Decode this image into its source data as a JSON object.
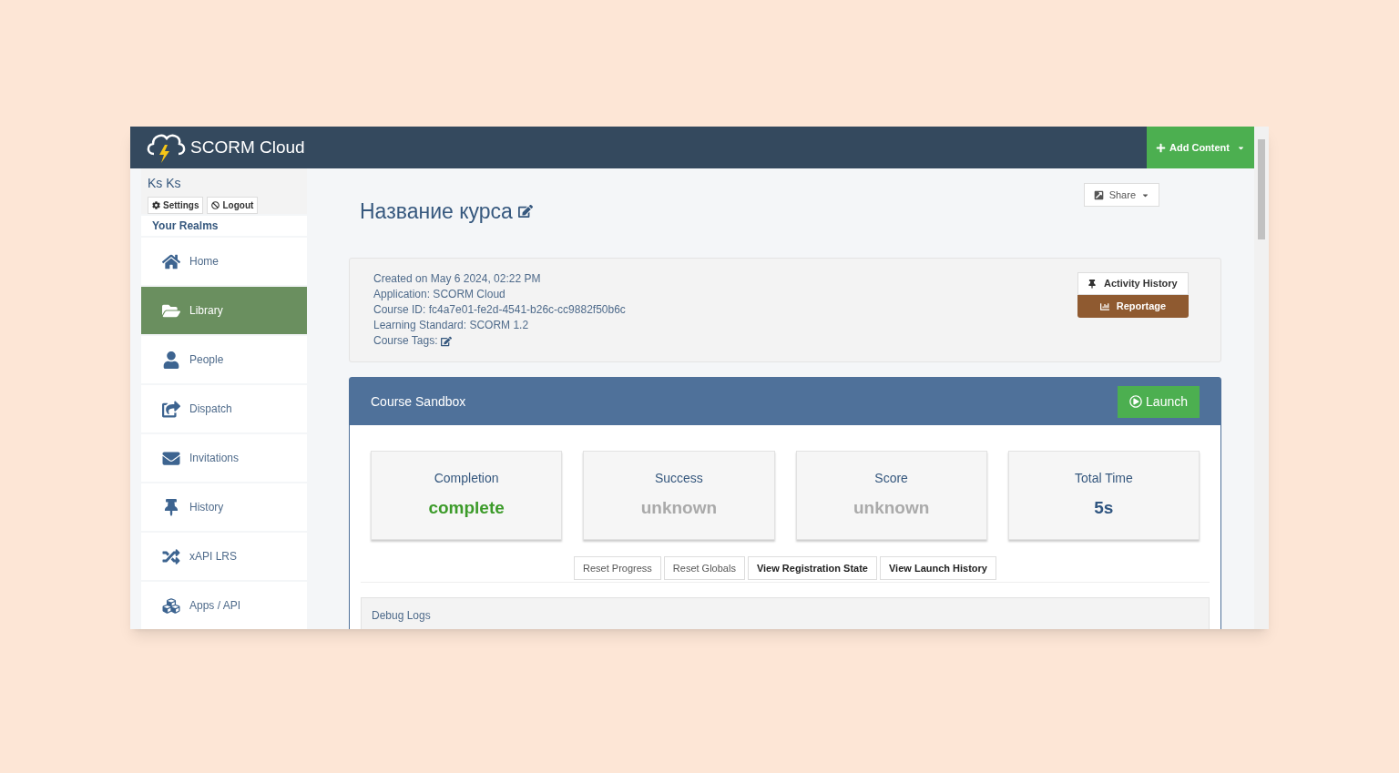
{
  "header": {
    "logo_text": "SCORM Cloud",
    "add_content_button": "Add Content"
  },
  "user": {
    "name": "Ks Ks",
    "buttons": [
      {
        "kind": "settings",
        "label": "Settings"
      },
      {
        "kind": "logout",
        "label": "Logout"
      }
    ]
  },
  "sidebar": {
    "heading": "Your Realms",
    "items": [
      {
        "kind": "home",
        "label": "Home",
        "selected": false
      },
      {
        "kind": "library",
        "label": "Library",
        "selected": true
      },
      {
        "kind": "people",
        "label": "People",
        "selected": false
      },
      {
        "kind": "dispatch",
        "label": "Dispatch",
        "selected": false
      },
      {
        "kind": "invitations",
        "label": "Invitations",
        "selected": false
      },
      {
        "kind": "history",
        "label": "History",
        "selected": false
      },
      {
        "kind": "xapi",
        "label": "xAPI LRS",
        "selected": false
      },
      {
        "kind": "apps",
        "label": "Apps / API",
        "selected": false
      }
    ]
  },
  "course": {
    "title": "Название курса",
    "share_button": "Share",
    "details": [
      "Created on May 6 2024, 02:22 PM",
      "Application: SCORM Cloud",
      "Course ID: fc4a7e01-fe2d-4541-b26c-cc9882f50b6c",
      "Learning Standard: SCORM 1.2",
      "Course Tags:"
    ],
    "activity_history_button": "Activity History",
    "reportage_button": "Reportage"
  },
  "sandbox": {
    "title": "Course Sandbox",
    "launch_button": "Launch",
    "metrics": [
      {
        "label": "Completion",
        "value": "complete",
        "color": "#3c9b2a"
      },
      {
        "label": "Success",
        "value": "unknown",
        "color": "#aaaaaa"
      },
      {
        "label": "Score",
        "value": "unknown",
        "color": "#aaaaaa"
      },
      {
        "label": "Total Time",
        "value": "5s",
        "color": "#2f5580"
      }
    ],
    "actions": [
      {
        "label": "Reset Progress",
        "kind": "plain"
      },
      {
        "label": "Reset Globals",
        "kind": "plain"
      },
      {
        "label": "View Registration State",
        "kind": "strong"
      },
      {
        "label": "View Launch History",
        "kind": "strong"
      }
    ],
    "debug_logs": "Debug Logs"
  }
}
